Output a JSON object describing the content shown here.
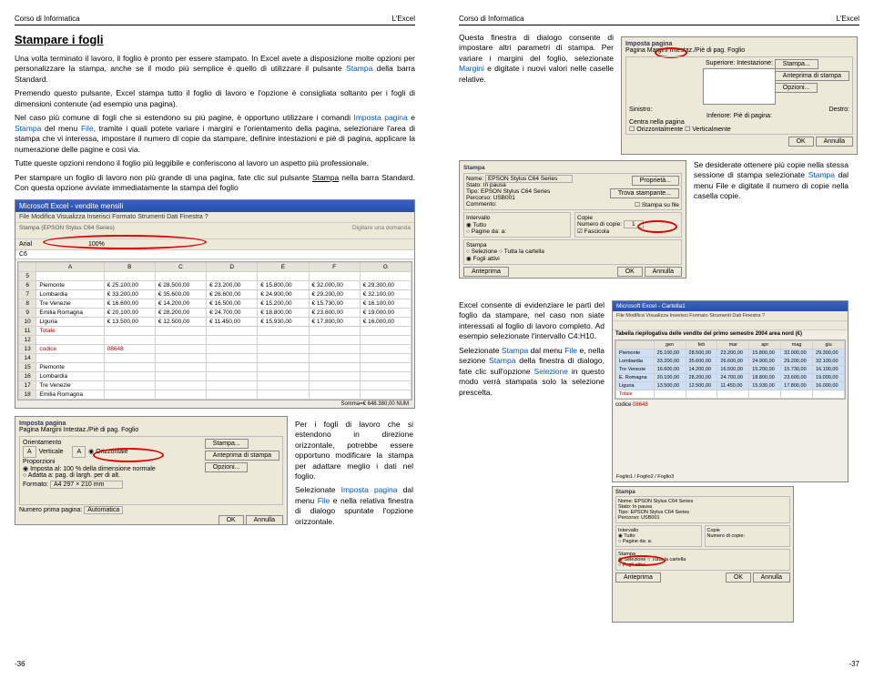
{
  "header": {
    "course": "Corso di Informatica",
    "topic": "L'Excel"
  },
  "leftPage": {
    "title": "Stampare i fogli",
    "p1a": "Una volta terminato il lavoro, il foglio è pronto per essere stampato. In Excel avete a disposizione molte opzioni per personalizzare la stampa, anche se il modo più semplice è quello di utilizzare il pulsante ",
    "p1b_blue": "Stampa",
    "p1c": " della barra Standard.",
    "p2": "Premendo questo pulsante, Excel stampa tutto il foglio di lavoro e l'opzione è consigliata soltanto per i fogli di dimensioni contenute (ad esempio una pagina).",
    "p3a": "Nel caso più comune di fogli che si estendono su più pagine, è opportuno utilizzare i comandi ",
    "p3b_blue": "Imposta pagina",
    "p3c": " e ",
    "p3d_blue": "Stampa",
    "p3e": " del menu ",
    "p3f_blue": "File",
    "p3g": ", tramite i quali potete variare i margini e l'orientamento della pagina, selezionare l'area di stampa che vi interessa, impostare il numero di copie da stampare, definire intestazioni e piè di pagina, applicare la numerazione delle pagine e così via.",
    "p4": "Tutte queste opzioni rendono il foglio più leggibile e conferiscono al lavoro un aspetto più professionale.",
    "p5a": "Per stampare un foglio di lavoro non più grande di una pagina, fate clic sul pulsante ",
    "p5b_u": "Stampa",
    "p5c": " nella barra Standard. Con questa opzione avviate immediatamente la stampa del foglio",
    "excelTitle": "Microsoft Excel - vendite mensili",
    "excelMenu": "File   Modifica   Visualizza   Inserisci   Formato   Strumenti   Dati   Finestra   ?",
    "stampaLabel": "Stampa (EPSON Stylus C64 Series)",
    "cellRef": "C6",
    "colHeaders": [
      "",
      "A",
      "B",
      "C",
      "D",
      "E",
      "F",
      "G"
    ],
    "rows": [
      [
        "5",
        "",
        "",
        "",
        "",
        "",
        "",
        ""
      ],
      [
        "6",
        "Piemonte",
        "€ 25.100,00",
        "€ 28.500,00",
        "€ 23.200,00",
        "€ 15.800,00",
        "€ 32.000,00",
        "€ 29.300,00"
      ],
      [
        "7",
        "Lombardia",
        "€ 33.200,00",
        "€ 35.600,00",
        "€ 26.600,00",
        "€ 24.900,00",
        "€ 29.200,00",
        "€ 32.100,00"
      ],
      [
        "8",
        "Tre Venezie",
        "€ 16.600,00",
        "€ 14.200,00",
        "€ 16.500,00",
        "€ 15.200,00",
        "€ 15.730,00",
        "€ 16.100,00"
      ],
      [
        "9",
        "Emilia Romagna",
        "€ 20.100,00",
        "€ 28.200,00",
        "€ 24.700,00",
        "€ 18.800,00",
        "€ 23.600,00",
        "€ 19.000,00"
      ],
      [
        "10",
        "Liguria",
        "€ 13.500,00",
        "€ 12.500,00",
        "€ 11.450,00",
        "€ 15.930,00",
        "€ 17.800,00",
        "€ 16.000,00"
      ],
      [
        "11",
        "Totale",
        "",
        "",
        "",
        "",
        "",
        ""
      ],
      [
        "12",
        "",
        "",
        "",
        "",
        "",
        "",
        ""
      ],
      [
        "13",
        "codice",
        "08648",
        "",
        "",
        "",
        "",
        ""
      ],
      [
        "14",
        "",
        "",
        "",
        "",
        "",
        "",
        ""
      ],
      [
        "15",
        "Piemonte",
        "",
        "",
        "",
        "",
        "",
        ""
      ],
      [
        "16",
        "Lombardia",
        "",
        "",
        "",
        "",
        "",
        ""
      ],
      [
        "17",
        "Tre Venezie",
        "",
        "",
        "",
        "",
        "",
        ""
      ],
      [
        "18",
        "Emilia Romagna",
        "",
        "",
        "",
        "",
        "",
        ""
      ]
    ],
    "status": "Somma=€ 648.380,00     NUM",
    "impostaTitle": "Imposta pagina",
    "impostaTabs": "Pagina   Margini   Intestaz./Piè di pag.   Foglio",
    "impostaOrient": "Orientamento",
    "impostaVert": "Verticale",
    "impostaOriz": "Orizzontale",
    "impostaStampa": "Stampa...",
    "impostaAnteprima": "Anteprima di stampa",
    "impostaOpzioni": "Opzioni...",
    "impostaProp": "Proporzioni",
    "impostaImp": "Imposta al:",
    "impostaPct": "100   % della dimensione normale",
    "impostaAdatta": "Adatta a:",
    "impostaPag": "pag. di largh. per   di alt.",
    "impostaFormato": "Formato:",
    "impostaA4": "A4 297 × 210 mm",
    "impostaNumPag": "Numero prima pagina:",
    "impostaAuto": "Automatica",
    "ok": "OK",
    "annulla": "Annulla",
    "sideText1": "Per i fogli di lavoro che si estendono in direzione orizzontale, potrebbe essere opportuno modificare la stampa per adattare meglio i dati nel foglio.",
    "sideText2a": "Selezionate ",
    "sideText2b_blue": "Imposta pagina",
    "sideText2c": " dal menu ",
    "sideText2d_blue": "File",
    "sideText2e": " e nella relativa finestra di dialogo spuntate l'opzione orizzontale.",
    "pageNum": "-36"
  },
  "rightPage": {
    "p1a": "Questa finestra di dialogo consente di impostare altri parametri di stampa. Per variare i margini del foglio, selezionate ",
    "p1b_blue": "Margini",
    "p1c": " e digitate i nuovi valori nelle caselle relative.",
    "impostaTitle": "Imposta pagina",
    "impostaTabs": "Pagina   Margini   Intestaz./Piè di pag.   Foglio",
    "impostaSup": "Superiore:",
    "impostaInf": "Inferiore:",
    "impostaSin": "Sinistro:",
    "impostaDes": "Destro:",
    "impostaInt": "Intestazione:",
    "impostaPie": "Piè di pagina:",
    "impostaCentra": "Centra nella pagina",
    "impostaOriz": "Orizzontalmente",
    "impostaVert": "Verticalmente",
    "impostaStampa": "Stampa...",
    "impostaAnteprima": "Anteprima di stampa",
    "impostaOpzioni": "Opzioni...",
    "ok": "OK",
    "annulla": "Annulla",
    "p2a": "Se desiderate ottenere più copie nella stessa sessione di stampa selezionate ",
    "p2b_blue": "Stampa",
    "p2c": " dal menu File e digitate il numero di copie nella casella copie.",
    "stampaTitle": "Stampa",
    "stampaNome": "Nome:",
    "stampaPrinter": "EPSON Stylus C64 Series",
    "stampaStato": "Stato:",
    "stampaStatoV": "In pausa",
    "stampaTipo": "Tipo:",
    "stampaTipoV": "EPSON Stylus C64 Series",
    "stampaPercorso": "Percorso:",
    "stampaPercorsoV": "USB001",
    "stampaCommento": "Commento:",
    "stampaProp": "Proprietà...",
    "stampaTrova": "Trova stampante...",
    "stampaSuFile": "Stampa su file",
    "stampaInterv": "Intervallo",
    "stampaTutto": "Tutto",
    "stampaPagine": "Pagine   da:   a:",
    "stampaCopie": "Copie",
    "stampaNumCopie": "Numero di copie:",
    "stampaFascic": "Fascicola",
    "stampaSezione": "Stampa",
    "stampaSelez": "Selezione",
    "stampaFogli": "Fogli attivi",
    "stampaCartella": "Tutta la cartella",
    "stampaAnteprima": "Anteprima",
    "p3a": "Excel consente di evidenziare le parti del foglio da stampare, nel caso non siate interessati al foglio di lavoro completo. Ad esempio selezionate l'intervallo C4:H10.",
    "p3b": "Selezionate ",
    "p3b_blue": "Stampa",
    "p3c": " dal menu ",
    "p3c_blue": "File",
    "p3d": " e, nella sezione ",
    "p3d_blue": "Stampa",
    "p3e": " della finestra di dialogo, fate clic sull'opzione ",
    "p3e_blue": "Selezione",
    "p3f": " in questo modo verrà stampata solo la selezione prescelta.",
    "excelSmallTitle": "Microsoft Excel - Cartella1",
    "excelSmallHeader": "Tabella riepilogativa delle vendite del primo semestre 2004 area nord (€)",
    "rowsSmall": [
      [
        "",
        "gen",
        "feb",
        "mar",
        "apr",
        "mag",
        "giu"
      ],
      [
        "Piemonte",
        "25.100,00",
        "28.500,00",
        "23.200,00",
        "15.800,00",
        "32.000,00",
        "29.300,00"
      ],
      [
        "Lombardia",
        "33.200,00",
        "35.600,00",
        "26.600,00",
        "24.900,00",
        "29.200,00",
        "32.100,00"
      ],
      [
        "Tre Venezie",
        "16.600,00",
        "14.200,00",
        "16.500,00",
        "15.200,00",
        "15.730,00",
        "16.100,00"
      ],
      [
        "E. Romagna",
        "20.100,00",
        "28.200,00",
        "24.700,00",
        "18.800,00",
        "23.600,00",
        "19.000,00"
      ],
      [
        "Liguria",
        "13.500,00",
        "12.500,00",
        "11.450,00",
        "15.930,00",
        "17.800,00",
        "16.000,00"
      ],
      [
        "Totale",
        "",
        "",
        "",
        "",
        "",
        ""
      ]
    ],
    "codice": "08648",
    "sheets": "Foglio1 / Foglio2 / Foglio3",
    "pageNum": "-37"
  }
}
